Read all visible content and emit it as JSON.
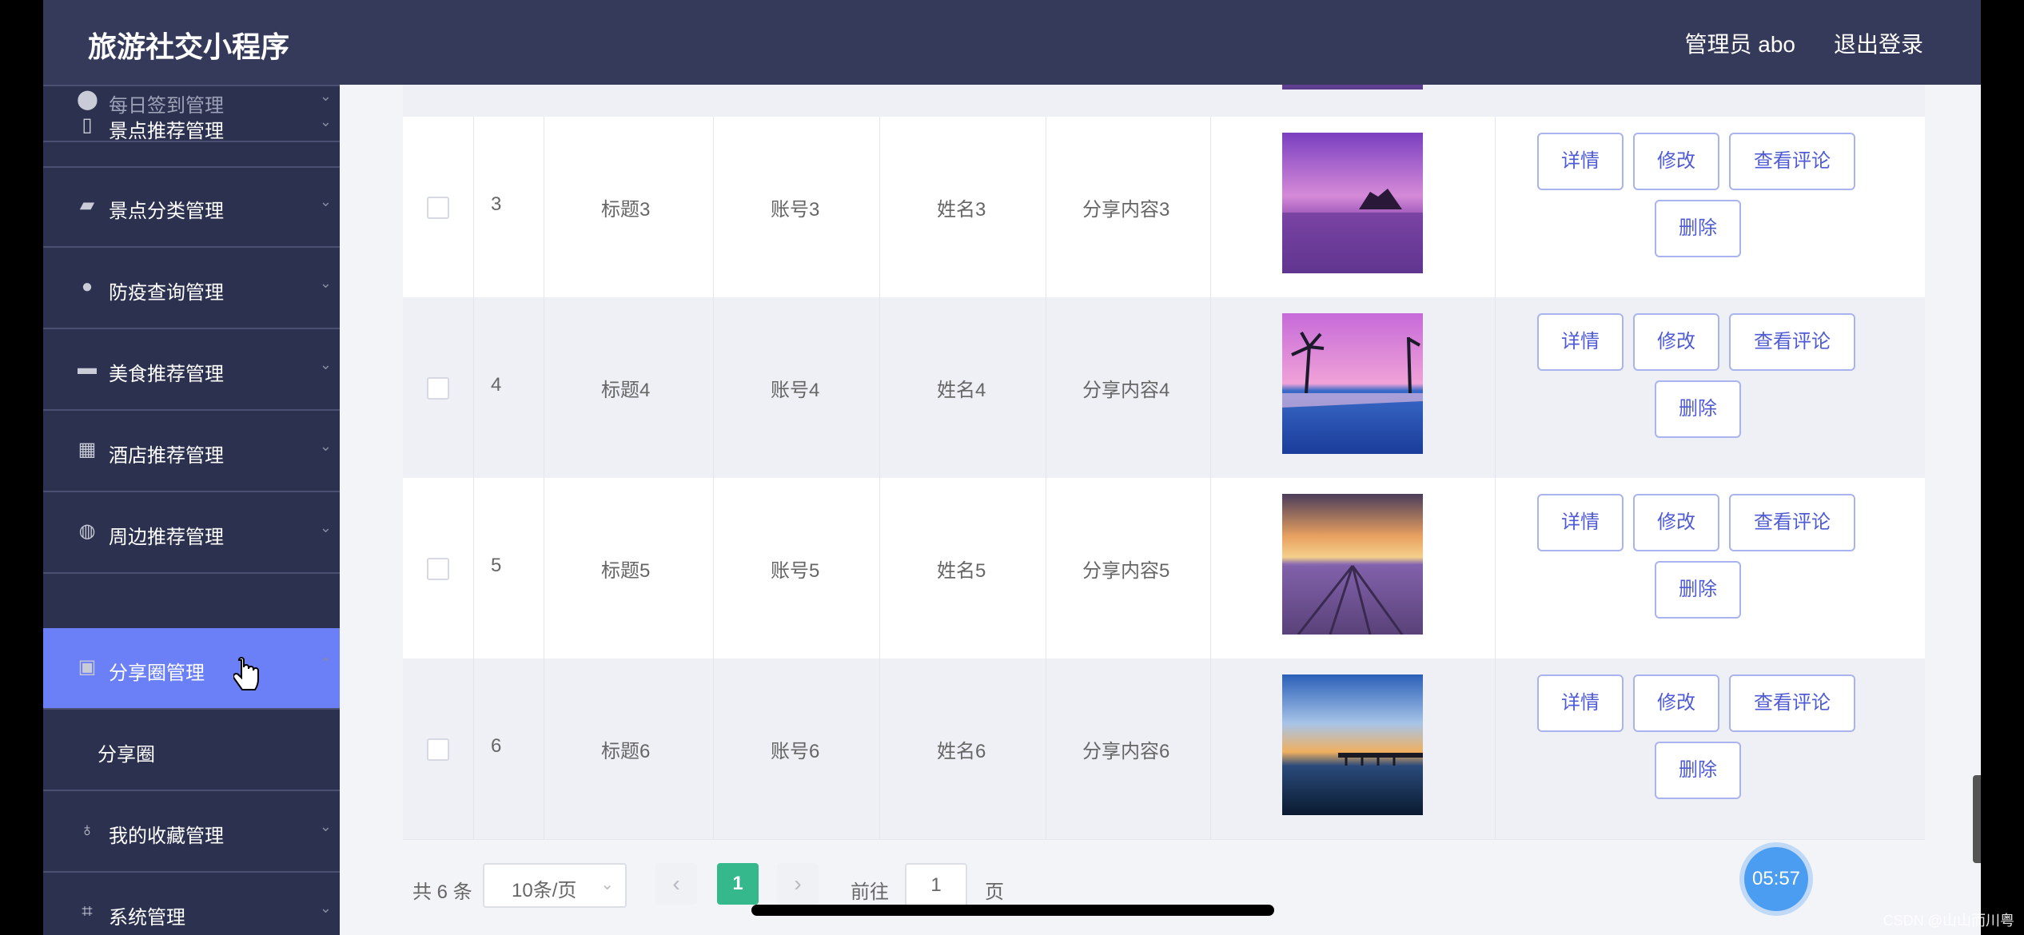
{
  "app": {
    "title": "旅游社交小程序",
    "user": "管理员 abo",
    "logout": "退出登录"
  },
  "sidebar": {
    "items": [
      {
        "label": "每日签到管理",
        "icon": "location-pin-icon"
      },
      {
        "label": "景点推荐管理",
        "icon": "phone-icon"
      },
      {
        "label": "景点分类管理",
        "icon": "wallet-icon"
      },
      {
        "label": "防疫查询管理",
        "icon": "user-icon"
      },
      {
        "label": "美食推荐管理",
        "icon": "printer-icon"
      },
      {
        "label": "酒店推荐管理",
        "icon": "grid-icon"
      },
      {
        "label": "周边推荐管理",
        "icon": "compass-icon"
      },
      {
        "label": "分享圈管理",
        "icon": "document-icon",
        "active": true
      },
      {
        "label": "我的收藏管理",
        "icon": "microphone-icon"
      },
      {
        "label": "系统管理",
        "icon": "crop-icon"
      }
    ],
    "sub_item": "分享圈"
  },
  "table": {
    "rows": [
      {
        "id": "3",
        "title": "标题3",
        "account": "账号3",
        "name": "姓名3",
        "content": "分享内容3",
        "image": "purple-sunset-island"
      },
      {
        "id": "4",
        "title": "标题4",
        "account": "账号4",
        "name": "姓名4",
        "content": "分享内容4",
        "image": "palm-tree-pool"
      },
      {
        "id": "5",
        "title": "标题5",
        "account": "账号5",
        "name": "姓名5",
        "content": "分享内容5",
        "image": "lavender-field-sunset"
      },
      {
        "id": "6",
        "title": "标题6",
        "account": "账号6",
        "name": "姓名6",
        "content": "分享内容6",
        "image": "pier-sunset"
      }
    ],
    "actions": {
      "detail": "详情",
      "edit": "修改",
      "comments": "查看评论",
      "delete": "删除"
    }
  },
  "pager": {
    "total": "共 6 条",
    "page_size": "10条/页",
    "current_page": "1",
    "goto_label": "前往",
    "goto_value": "1",
    "goto_suffix": "页"
  },
  "overlay": {
    "timer": "05:57",
    "watermark": "CSDN @山山而川粤"
  },
  "colors": {
    "topbar": "#353a5a",
    "sidebar": "#2c3150",
    "active": "#6b7ff7",
    "pager_active": "#35b98c"
  }
}
